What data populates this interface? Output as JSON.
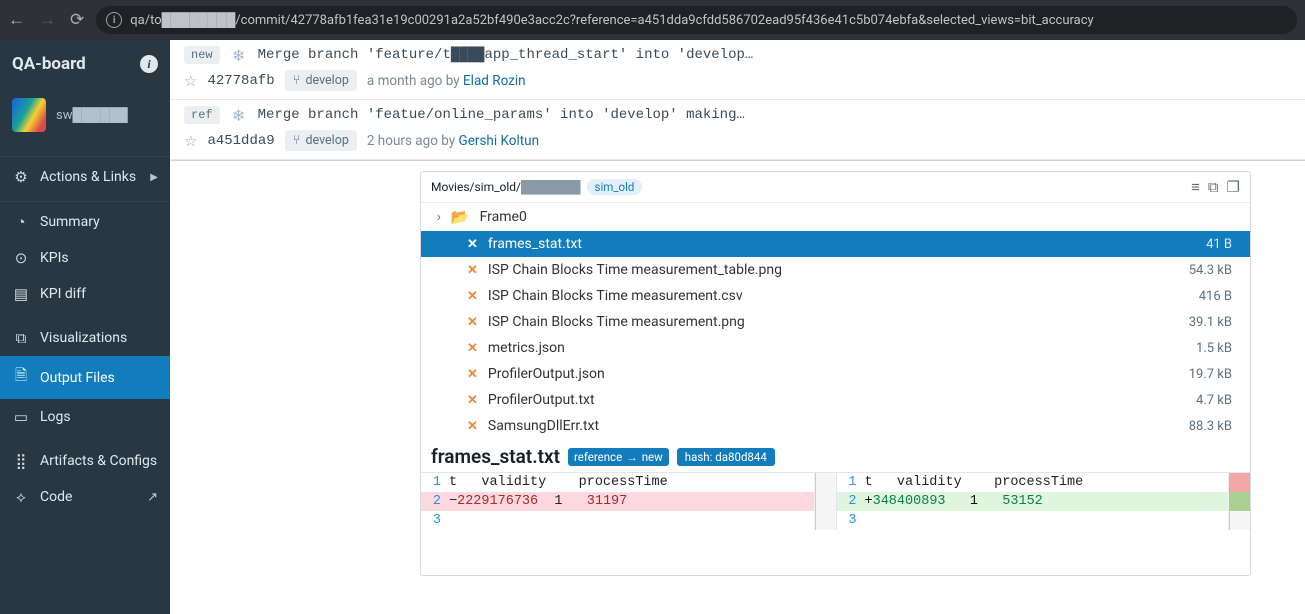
{
  "browser": {
    "url": "qa/to████████/commit/42778afb1fea31e19c00291a2a52bf490e3acc2c?reference=a451dda9cfdd586702ead95f436e41c5b074ebfa&selected_views=bit_accuracy"
  },
  "sidebar": {
    "brand": "QA-board",
    "project": "sw██████",
    "items": [
      {
        "icon": "⚙",
        "label": "Actions & Links",
        "caret": true
      },
      {
        "icon": "◔",
        "label": "Summary"
      },
      {
        "icon": "⊙",
        "label": "KPIs"
      },
      {
        "icon": "▤",
        "label": "KPI diff"
      },
      {
        "icon": "⧉",
        "label": "Visualizations"
      },
      {
        "icon": "🗎",
        "label": "Output Files"
      },
      {
        "icon": "▭",
        "label": "Logs"
      },
      {
        "icon": "⣿",
        "label": "Artifacts & Configs"
      },
      {
        "icon": "⟡",
        "label": "Code",
        "external": true
      }
    ]
  },
  "commits": {
    "new": {
      "tag": "new",
      "message": "Merge branch 'feature/t████app_thread_start' into 'develop…",
      "sha": "42778afb",
      "branch": "develop",
      "when": "a month ago",
      "by_prefix": "by ",
      "author": "Elad Rozin"
    },
    "ref": {
      "tag": "ref",
      "message": "Merge branch 'featue/online_params' into 'develop' making…",
      "sha": "a451dda9",
      "branch": "develop",
      "when": "2 hours ago",
      "by_prefix": "by ",
      "author": "Gershi Koltun"
    }
  },
  "panel": {
    "breadcrumb_prefix": "Movies/sim_old/",
    "breadcrumb_dim": "███████",
    "chip": "sim_old",
    "folder": "Frame0",
    "files": [
      {
        "name": "frames_stat.txt",
        "size": "41 B",
        "selected": true
      },
      {
        "name": "ISP Chain Blocks Time measurement_table.png",
        "size": "54.3 kB"
      },
      {
        "name": "ISP Chain Blocks Time measurement.csv",
        "size": "416 B"
      },
      {
        "name": "ISP Chain Blocks Time measurement.png",
        "size": "39.1 kB"
      },
      {
        "name": "metrics.json",
        "size": "1.5 kB"
      },
      {
        "name": "ProfilerOutput.json",
        "size": "19.7 kB"
      },
      {
        "name": "ProfilerOutput.txt",
        "size": "4.7 kB"
      },
      {
        "name": "SamsungDllErr.txt",
        "size": "88.3 kB"
      }
    ]
  },
  "diff": {
    "filename": "frames_stat.txt",
    "badge_ref": "reference",
    "badge_arrow": "→",
    "badge_new": "new",
    "hash_label": "hash: da80d844",
    "left": {
      "l1": {
        "n": "1",
        "txt": "t   validity    processTime"
      },
      "l2": {
        "n": "2",
        "sign": "−",
        "v1": "2229176736",
        "v2": "1",
        "v3": "31197"
      },
      "l3": {
        "n": "3",
        "txt": ""
      }
    },
    "right": {
      "l1": {
        "n": "1",
        "txt": "t   validity    processTime"
      },
      "l2": {
        "n": "2",
        "sign": "+",
        "v1": "348400893",
        "v2": "1",
        "v3": "53152"
      },
      "l3": {
        "n": "3",
        "txt": ""
      }
    }
  }
}
